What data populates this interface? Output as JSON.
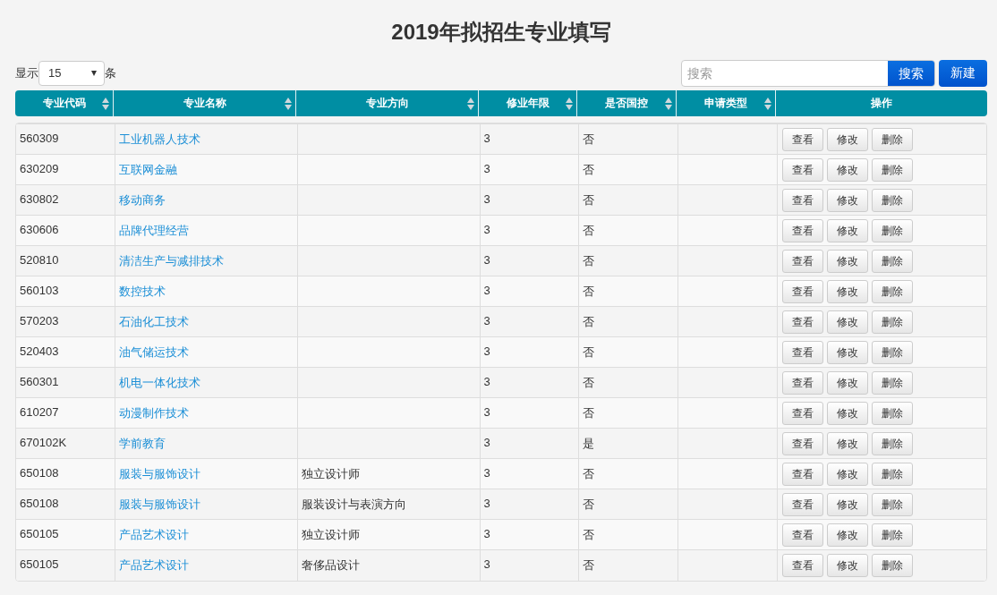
{
  "title": "2019年拟招生专业填写",
  "page_size": {
    "label_before": "显示",
    "value": "15",
    "label_after": "条"
  },
  "search": {
    "placeholder": "搜索",
    "button": "搜索"
  },
  "new_button": "新建",
  "columns": [
    {
      "label": "专业代码",
      "sortable": true
    },
    {
      "label": "专业名称",
      "sortable": true
    },
    {
      "label": "专业方向",
      "sortable": true
    },
    {
      "label": "修业年限",
      "sortable": true
    },
    {
      "label": "是否国控",
      "sortable": true
    },
    {
      "label": "申请类型",
      "sortable": true
    },
    {
      "label": "操作",
      "sortable": false
    }
  ],
  "rows": [
    {
      "code": "560309",
      "name": "工业机器人技术",
      "direction": "",
      "years": "3",
      "controlled": "否",
      "type": "",
      "actions": [
        "查看",
        "修改",
        "删除"
      ]
    },
    {
      "code": "630209",
      "name": "互联网金融",
      "direction": "",
      "years": "3",
      "controlled": "否",
      "type": "",
      "actions": [
        "查看",
        "修改",
        "删除"
      ]
    },
    {
      "code": "630802",
      "name": "移动商务",
      "direction": "",
      "years": "3",
      "controlled": "否",
      "type": "",
      "actions": [
        "查看",
        "修改",
        "删除"
      ]
    },
    {
      "code": "630606",
      "name": "品牌代理经营",
      "direction": "",
      "years": "3",
      "controlled": "否",
      "type": "",
      "actions": [
        "查看",
        "修改",
        "删除"
      ]
    },
    {
      "code": "520810",
      "name": "清洁生产与减排技术",
      "direction": "",
      "years": "3",
      "controlled": "否",
      "type": "",
      "actions": [
        "查看",
        "修改",
        "删除"
      ]
    },
    {
      "code": "560103",
      "name": "数控技术",
      "direction": "",
      "years": "3",
      "controlled": "否",
      "type": "",
      "actions": [
        "查看",
        "修改",
        "删除"
      ]
    },
    {
      "code": "570203",
      "name": "石油化工技术",
      "direction": "",
      "years": "3",
      "controlled": "否",
      "type": "",
      "actions": [
        "查看",
        "修改",
        "删除"
      ]
    },
    {
      "code": "520403",
      "name": "油气储运技术",
      "direction": "",
      "years": "3",
      "controlled": "否",
      "type": "",
      "actions": [
        "查看",
        "修改",
        "删除"
      ]
    },
    {
      "code": "560301",
      "name": "机电一体化技术",
      "direction": "",
      "years": "3",
      "controlled": "否",
      "type": "",
      "actions": [
        "查看",
        "修改",
        "删除"
      ]
    },
    {
      "code": "610207",
      "name": "动漫制作技术",
      "direction": "",
      "years": "3",
      "controlled": "否",
      "type": "",
      "actions": [
        "查看",
        "修改",
        "删除"
      ]
    },
    {
      "code": "670102K",
      "name": "学前教育",
      "direction": "",
      "years": "3",
      "controlled": "是",
      "type": "",
      "actions": [
        "查看",
        "修改",
        "删除"
      ]
    },
    {
      "code": "650108",
      "name": "服装与服饰设计",
      "direction": "独立设计师",
      "years": "3",
      "controlled": "否",
      "type": "",
      "actions": [
        "查看",
        "修改",
        "删除"
      ]
    },
    {
      "code": "650108",
      "name": "服装与服饰设计",
      "direction": "服装设计与表演方向",
      "years": "3",
      "controlled": "否",
      "type": "",
      "actions": [
        "查看",
        "修改",
        "删除"
      ]
    },
    {
      "code": "650105",
      "name": "产品艺术设计",
      "direction": "独立设计师",
      "years": "3",
      "controlled": "否",
      "type": "",
      "actions": [
        "查看",
        "修改",
        "删除"
      ]
    },
    {
      "code": "650105",
      "name": "产品艺术设计",
      "direction": "奢侈品设计",
      "years": "3",
      "controlled": "否",
      "type": "",
      "actions": [
        "查看",
        "修改",
        "删除"
      ]
    }
  ]
}
